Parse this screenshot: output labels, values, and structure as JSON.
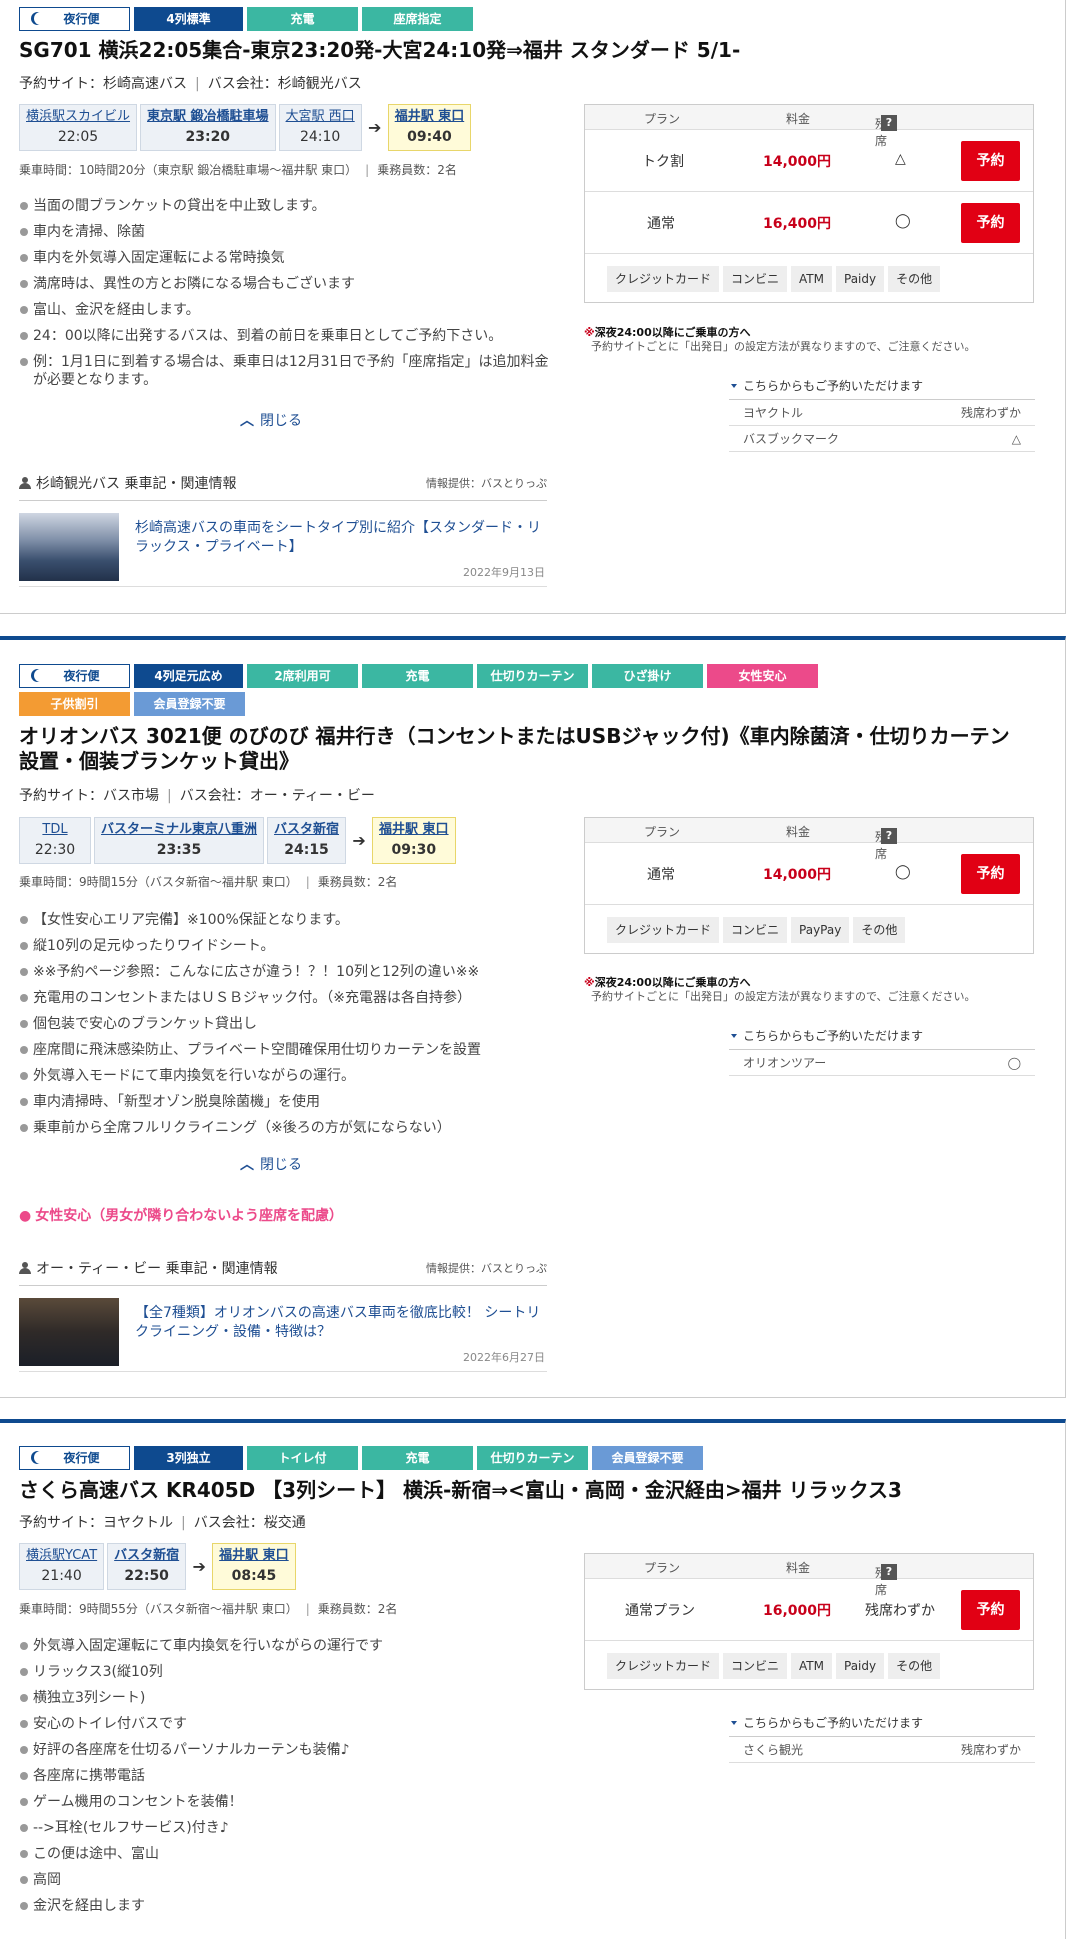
{
  "common": {
    "plan_header": "プラン",
    "price_header": "料金",
    "seat_header": "残席",
    "help_mark": "?",
    "reserve_label": "予約",
    "close_label": "閉じる",
    "note_title": "深夜24:00以降にご乗車の方へ",
    "note_ast": "※",
    "note_body": "予約サイトごとに「出発日」の設定方法が異なりますので、ご注意ください。",
    "alt_header": "こちらからもご予約いただけます",
    "provider_label": "情報提供：バスとりっぷ"
  },
  "cards": [
    {
      "tags": [
        "夜行便",
        "4列標準",
        "充電",
        "座席指定"
      ],
      "title": "SG701 横浜22:05集合-東京23:20発-大宮24:10発⇒福井 スタンダード 5/1-",
      "site": "予約サイト：杉崎高速バス",
      "company": "バス会社：杉崎観光バス",
      "stops": [
        {
          "name": "横浜駅スカイビル",
          "time": "22:05"
        },
        {
          "name": "東京駅 鍛冶橋駐車場",
          "time": "23:20"
        },
        {
          "name": "大宮駅 西口",
          "time": "24:10"
        },
        {
          "name": "福井駅 東口",
          "time": "09:40"
        }
      ],
      "duration": "乗車時間：10時間20分（東京駅 鍛冶橋駐車場〜福井駅 東口）",
      "passengers": "乗務員数：2名",
      "bullets": [
        "当面の間ブランケットの貸出を中止致します。",
        "車内を清掃、除菌",
        "車内を外気導入固定運転による常時換気",
        "満席時は、異性の方とお隣になる場合もございます",
        "富山、金沢を経由します。",
        "24：00以降に出発するバスは、到着の前日を乗車日としてご予約下さい。",
        "例：1月1日に到着する場合は、乗車日は12月31日で予約「座席指定」は追加料金が必要となります。"
      ],
      "related_title": "杉崎観光バス 乗車記・関連情報",
      "related_link": "杉崎高速バスの車両をシートタイプ別に紹介【スタンダード・リラックス・プライベート】",
      "related_date": "2022年9月13日",
      "plans": [
        {
          "name": "トク割",
          "price": "14,000円",
          "seat": "△"
        },
        {
          "name": "通常",
          "price": "16,400円",
          "seat": "◯"
        }
      ],
      "pays": [
        "クレジットカード",
        "コンビニ",
        "ATM",
        "Paidy",
        "その他"
      ],
      "alts": [
        {
          "name": "ヨヤクトル",
          "status": "残席わずか"
        },
        {
          "name": "バスブックマーク",
          "status": "△"
        }
      ]
    },
    {
      "tags": [
        "夜行便",
        "4列足元広め",
        "2席利用可",
        "充電",
        "仕切りカーテン",
        "ひざ掛け",
        "女性安心",
        "子供割引",
        "会員登録不要"
      ],
      "title": "オリオンバス 3021便 のびのび 福井行き（コンセントまたはUSBジャック付)《車内除菌済・仕切りカーテン設置・個装ブランケット貸出》",
      "site": "予約サイト：バス市場",
      "company": "バス会社：オー・ティー・ビー",
      "stops": [
        {
          "name": "TDL",
          "time": "22:30"
        },
        {
          "name": "バスターミナル東京八重洲",
          "time": "23:35"
        },
        {
          "name": "バスタ新宿",
          "time": "24:15"
        },
        {
          "name": "福井駅 東口",
          "time": "09:30"
        }
      ],
      "duration": "乗車時間：9時間15分（バスタ新宿〜福井駅 東口）",
      "passengers": "乗務員数：2名",
      "bullets": [
        "【女性安心エリア完備】※100%保証となります。",
        "縦10列の足元ゆったりワイドシート。",
        "※※予約ページ参照：こんなに広さが違う！？！10列と12列の違い※※",
        "充電用のコンセントまたはＵＳＢジャック付。（※充電器は各自持参）",
        "個包装で安心のブランケット貸出し",
        "座席間に飛沫感染防止、プライベート空間確保用仕切りカーテンを設置",
        "外気導入モードにて車内換気を行いながらの運行。",
        "車内清掃時、「新型オゾン脱臭除菌機」を使用",
        "乗車前から全席フルリクライニング（※後ろの方が気にならない）"
      ],
      "pink_note": "女性安心（男女が隣り合わないよう座席を配慮）",
      "related_title": "オー・ティー・ビー 乗車記・関連情報",
      "related_link": "【全7種類】オリオンバスの高速バス車両を徹底比較！ シートリクライニング・設備・特徴は？",
      "related_date": "2022年6月27日",
      "plans": [
        {
          "name": "通常",
          "price": "14,000円",
          "seat": "◯"
        }
      ],
      "pays": [
        "クレジットカード",
        "コンビニ",
        "PayPay",
        "その他"
      ],
      "alts": [
        {
          "name": "オリオンツアー",
          "status": "◯"
        }
      ]
    },
    {
      "tags": [
        "夜行便",
        "3列独立",
        "トイレ付",
        "充電",
        "仕切りカーテン",
        "会員登録不要"
      ],
      "title": "さくら高速バス KR405D 【3列シート】 横浜-新宿⇒<富山・高岡・金沢経由>福井 リラックス3",
      "site": "予約サイト：ヨヤクトル",
      "company": "バス会社：桜交通",
      "stops": [
        {
          "name": "横浜駅YCAT",
          "time": "21:40"
        },
        {
          "name": "バスタ新宿",
          "time": "22:50"
        },
        {
          "name": "福井駅 東口",
          "time": "08:45"
        }
      ],
      "duration": "乗車時間：9時間55分（バスタ新宿〜福井駅 東口）",
      "passengers": "乗務員数：2名",
      "bullets": [
        "外気導入固定運転にて車内換気を行いながらの運行です",
        "リラックス3(縦10列",
        "横独立3列シート)",
        "安心のトイレ付バスです",
        "好評の各座席を仕切るパーソナルカーテンも装備♪",
        "各座席に携帯電話",
        "ゲーム機用のコンセントを装備！",
        "-->耳栓(セルフサービス)付き♪",
        "この便は途中、富山",
        "高岡",
        "金沢を経由します"
      ],
      "plans": [
        {
          "name": "通常プラン",
          "price": "16,000円",
          "seat": "残席わずか"
        }
      ],
      "pays": [
        "クレジットカード",
        "コンビニ",
        "ATM",
        "Paidy",
        "その他"
      ],
      "alts": [
        {
          "name": "さくら観光",
          "status": "残席わずか"
        }
      ]
    }
  ]
}
